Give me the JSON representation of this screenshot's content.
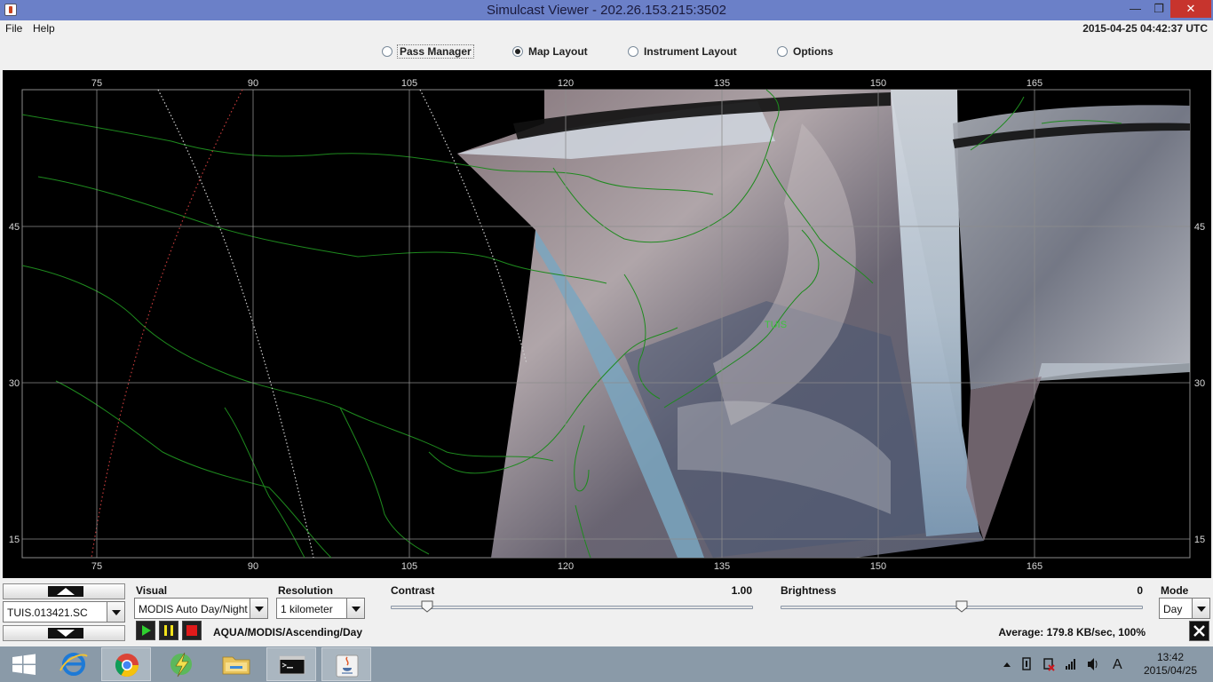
{
  "window": {
    "title": "Simulcast Viewer - 202.26.153.215:3502",
    "min": "—",
    "max": "❐",
    "close": "✕"
  },
  "menu": {
    "items": [
      "File",
      "Help"
    ],
    "clock": "2015-04-25 04:42:37 UTC"
  },
  "tabs": [
    {
      "label": "Pass Manager",
      "selected": false
    },
    {
      "label": "Map Layout",
      "selected": true
    },
    {
      "label": "Instrument Layout",
      "selected": false
    },
    {
      "label": "Options",
      "selected": false
    }
  ],
  "map": {
    "lon_labels": [
      "75",
      "90",
      "105",
      "120",
      "135",
      "150",
      "165"
    ],
    "lat_labels": [
      "45",
      "30",
      "15"
    ],
    "station_label": "TUIS",
    "colors": {
      "background": "#000000",
      "grid": "#8c8c8c",
      "coast": "#1e8a1e",
      "label": "#d8d8d8"
    }
  },
  "controls": {
    "pass_file": "TUIS.013421.SC",
    "visual": {
      "label": "Visual",
      "value": "MODIS Auto Day/Night"
    },
    "resolution": {
      "label": "Resolution",
      "value": "1 kilometer"
    },
    "contrast": {
      "label": "Contrast",
      "value": "1.00",
      "level": 0.1
    },
    "brightness": {
      "label": "Brightness",
      "value": "0",
      "level": 0.5
    },
    "mode": {
      "label": "Mode",
      "value": "Day"
    },
    "status": "AQUA/MODIS/Ascending/Day",
    "average": "Average: 179.8 KB/sec, 100%"
  },
  "taskbar": {
    "items": [
      "windows-start",
      "internet-explorer",
      "chrome",
      "network-tool",
      "file-explorer",
      "command-prompt",
      "java"
    ],
    "time": "13:42",
    "date": "2015/04/25",
    "ime": "A"
  }
}
